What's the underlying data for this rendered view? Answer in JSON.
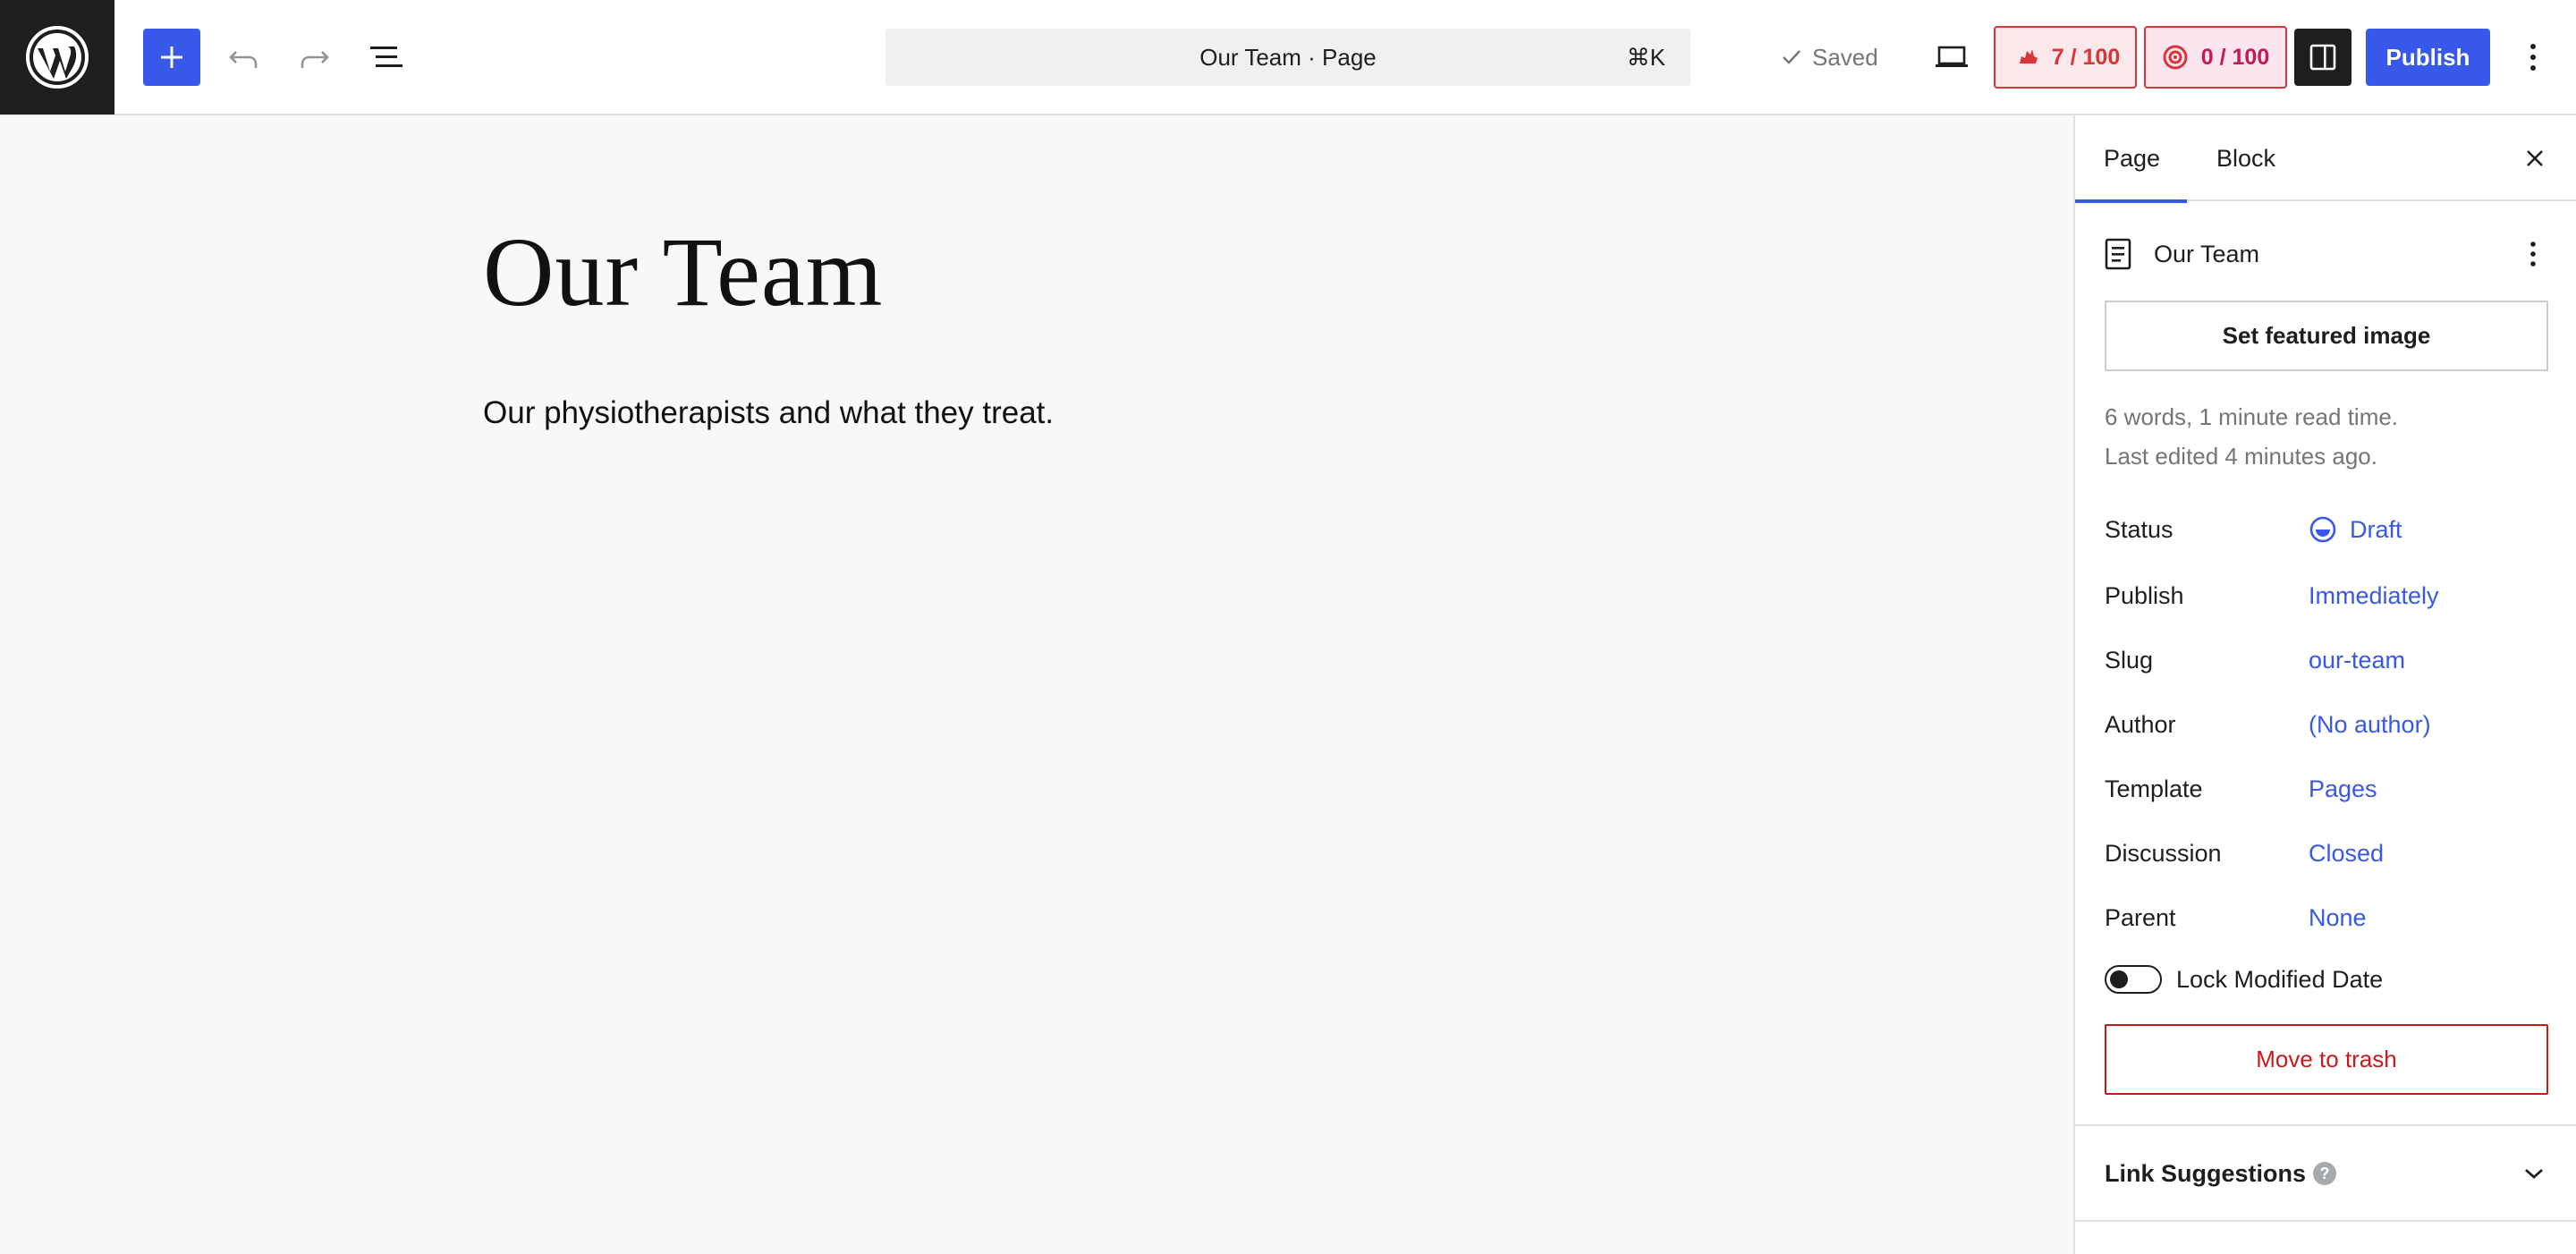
{
  "toolbar": {
    "command_bar_text": "Our Team · Page",
    "command_shortcut": "⌘K",
    "saved_label": "Saved",
    "score_seo": "7 / 100",
    "score_readability": "0 / 100",
    "publish_label": "Publish"
  },
  "editor": {
    "title": "Our Team",
    "paragraph": "Our physiotherapists and what they treat."
  },
  "sidebar": {
    "tabs": [
      "Page",
      "Block"
    ],
    "document_title": "Our Team",
    "featured_image_label": "Set featured image",
    "meta_words": "6 words, 1 minute read time.",
    "meta_edited": "Last edited 4 minutes ago.",
    "properties": [
      {
        "label": "Status",
        "value": "Draft"
      },
      {
        "label": "Publish",
        "value": "Immediately"
      },
      {
        "label": "Slug",
        "value": "our-team"
      },
      {
        "label": "Author",
        "value": "(No author)"
      },
      {
        "label": "Template",
        "value": "Pages"
      },
      {
        "label": "Discussion",
        "value": "Closed"
      },
      {
        "label": "Parent",
        "value": "None"
      }
    ],
    "lock_modified_label": "Lock Modified Date",
    "lock_modified_on": false,
    "trash_label": "Move to trash",
    "link_suggestions_label": "Link Suggestions",
    "help_glyph": "?"
  },
  "colors": {
    "accent": "#3858e9",
    "danger": "#cc1818",
    "score_red": "#d63638"
  }
}
